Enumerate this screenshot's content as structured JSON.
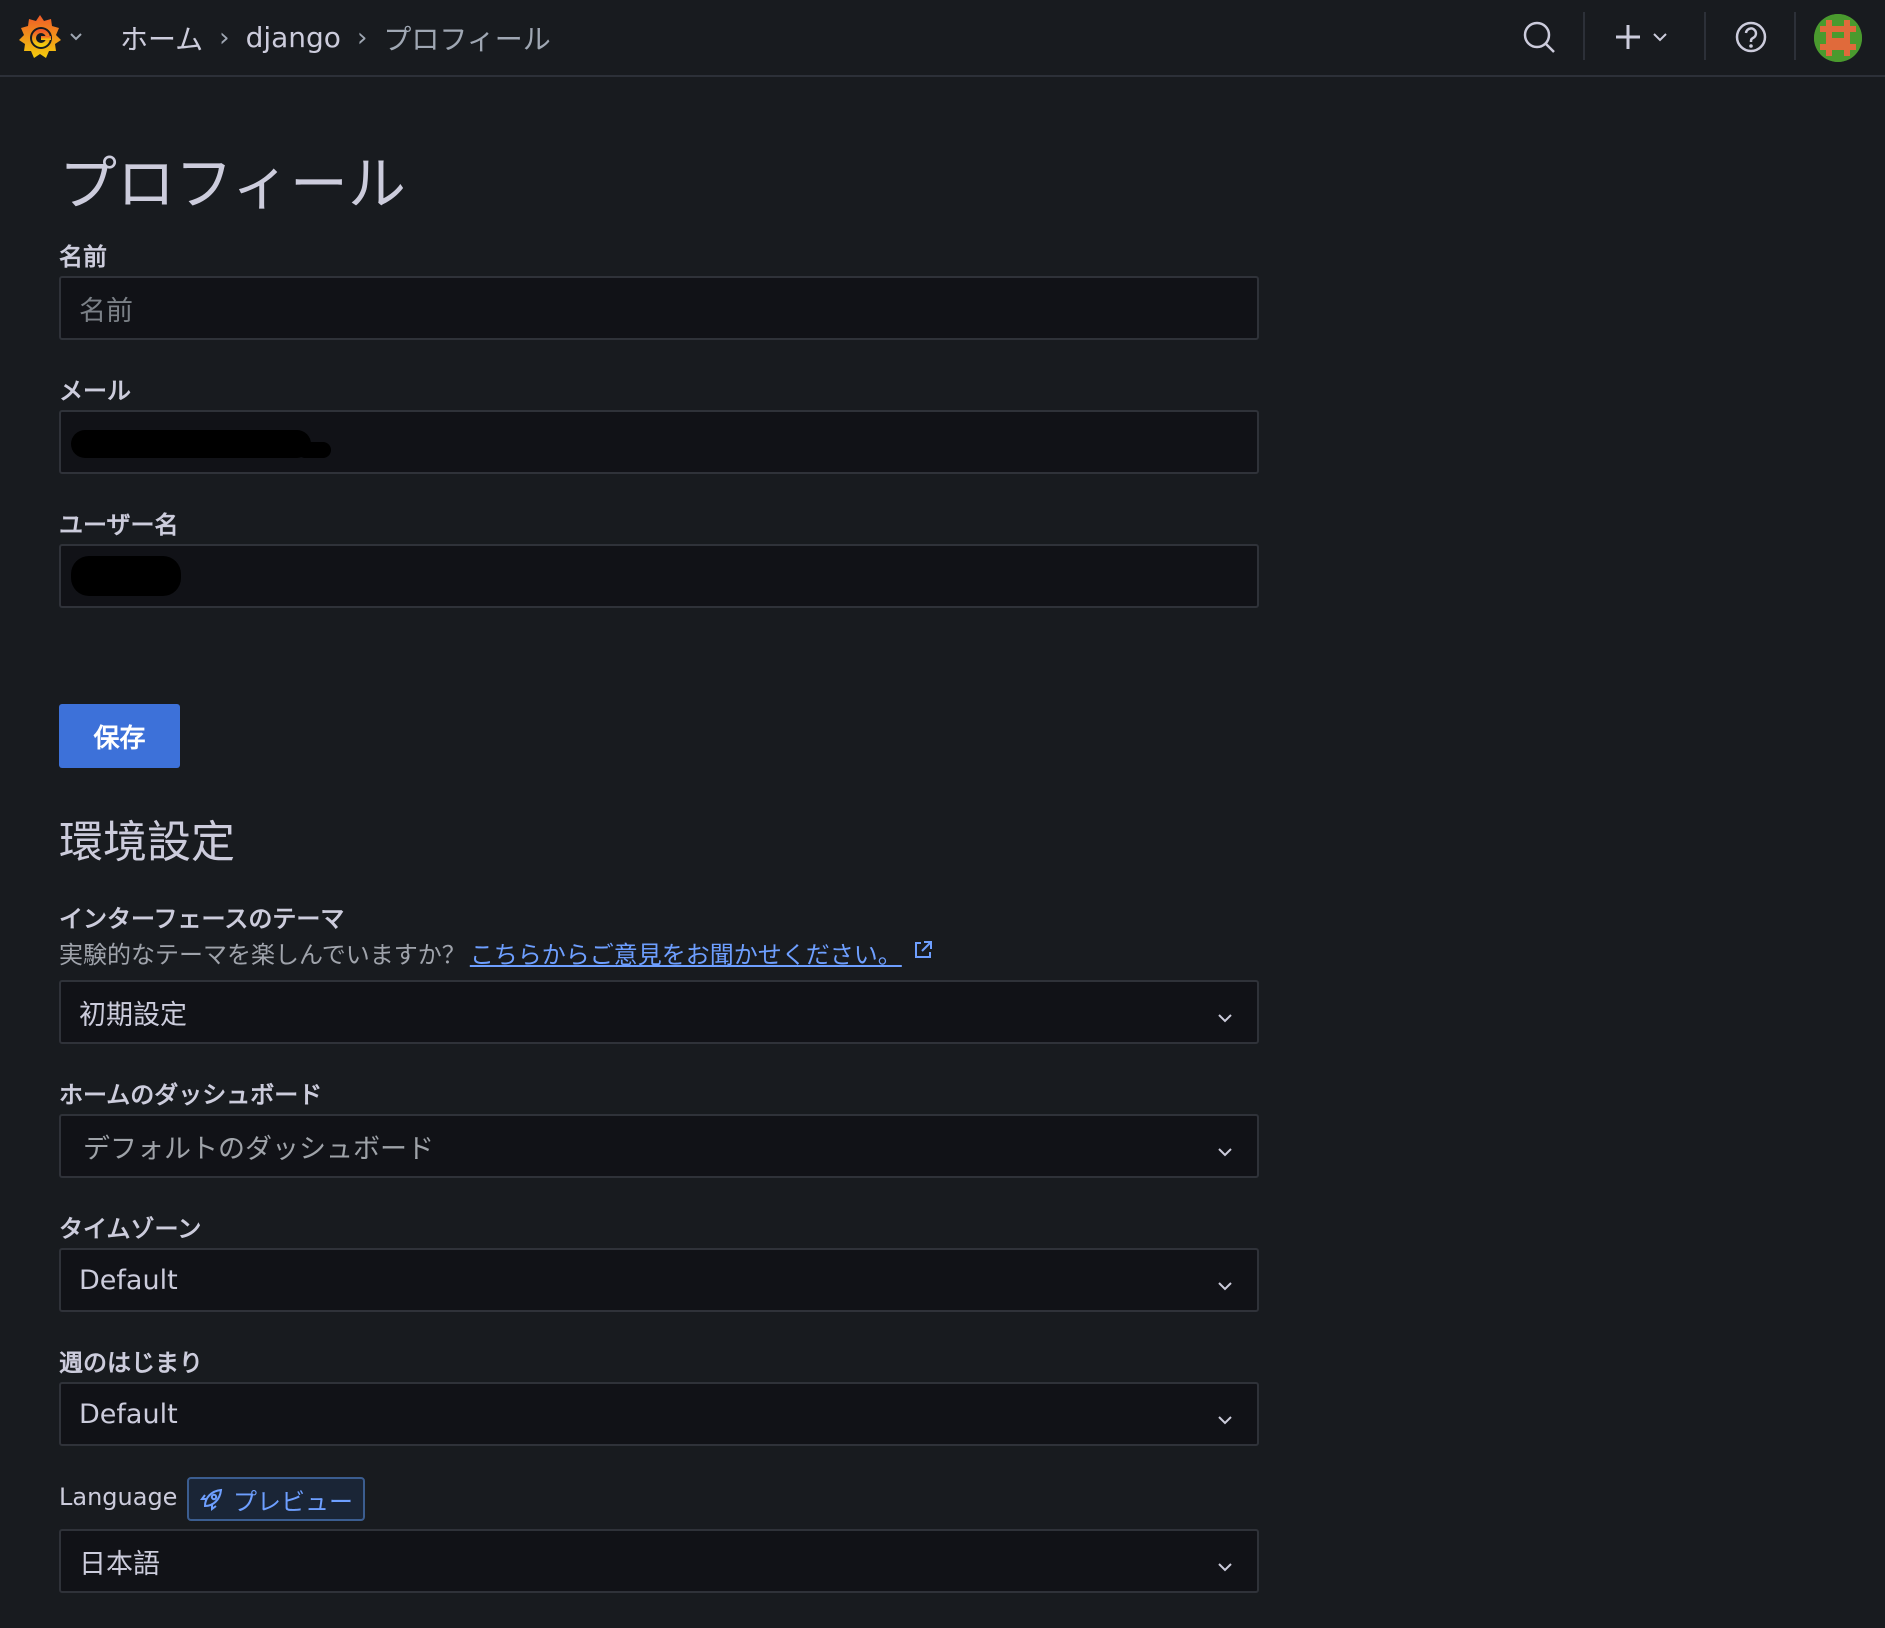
{
  "header": {
    "logo_icon": "grafana-logo-icon",
    "breadcrumb": [
      "ホーム",
      "django",
      "プロフィール"
    ],
    "icons": [
      "search-icon",
      "plus-icon",
      "help-icon",
      "avatar"
    ]
  },
  "profile": {
    "title": "プロフィール",
    "name_label": "名前",
    "name_placeholder": "名前",
    "email_label": "メール",
    "username_label": "ユーザー名",
    "save_label": "保存"
  },
  "preferences": {
    "title": "環境設定",
    "theme_label": "インターフェースのテーマ",
    "theme_desc": "実験的なテーマを楽しんでいますか？",
    "theme_feedback_link": "こちらからご意見をお聞かせください。",
    "theme_value": "初期設定",
    "home_dashboard_label": "ホームのダッシュボード",
    "home_dashboard_value": "デフォルトのダッシュボード",
    "timezone_label": "タイムゾーン",
    "timezone_value": "Default",
    "week_start_label": "週のはじまり",
    "week_start_value": "Default",
    "language_label": "Language",
    "language_badge": "プレビュー",
    "language_value": "日本語"
  },
  "colors": {
    "background": "#181b1f",
    "input_bg": "#111217",
    "primary_button": "#3d71d9",
    "link": "#6e9fff"
  }
}
